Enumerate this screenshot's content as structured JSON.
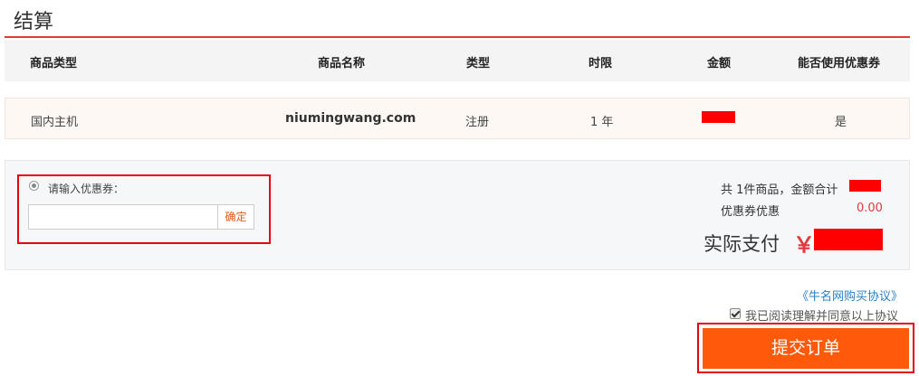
{
  "page": {
    "title": "结算"
  },
  "table": {
    "headers": [
      "商品类型",
      "商品名称",
      "类型",
      "时限",
      "金额",
      "能否使用优惠券"
    ],
    "row": {
      "product_type": "国内主机",
      "product_name": "niumingwang.com",
      "type": "注册",
      "duration": "1 年",
      "amount": "",
      "coupon_allowed": "是"
    }
  },
  "coupon": {
    "label": "请输入优惠券：",
    "input_value": "",
    "confirm_label": "确定"
  },
  "summary": {
    "total_text": "共 1件商品，金额合计",
    "discount_label": "优惠券优惠",
    "discount_value": "0.00",
    "pay_label": "实际支付",
    "currency_symbol": "￥"
  },
  "agreement": {
    "link_text": "《牛名网购买协议》",
    "checkbox_text": "我已阅读理解并同意以上协议",
    "checked": true
  },
  "submit": {
    "label": "提交订单"
  },
  "colors": {
    "accent": "#e4393c",
    "submit": "#ff5a0a",
    "link": "#2a7fc4",
    "redaction": "#ff0000"
  }
}
